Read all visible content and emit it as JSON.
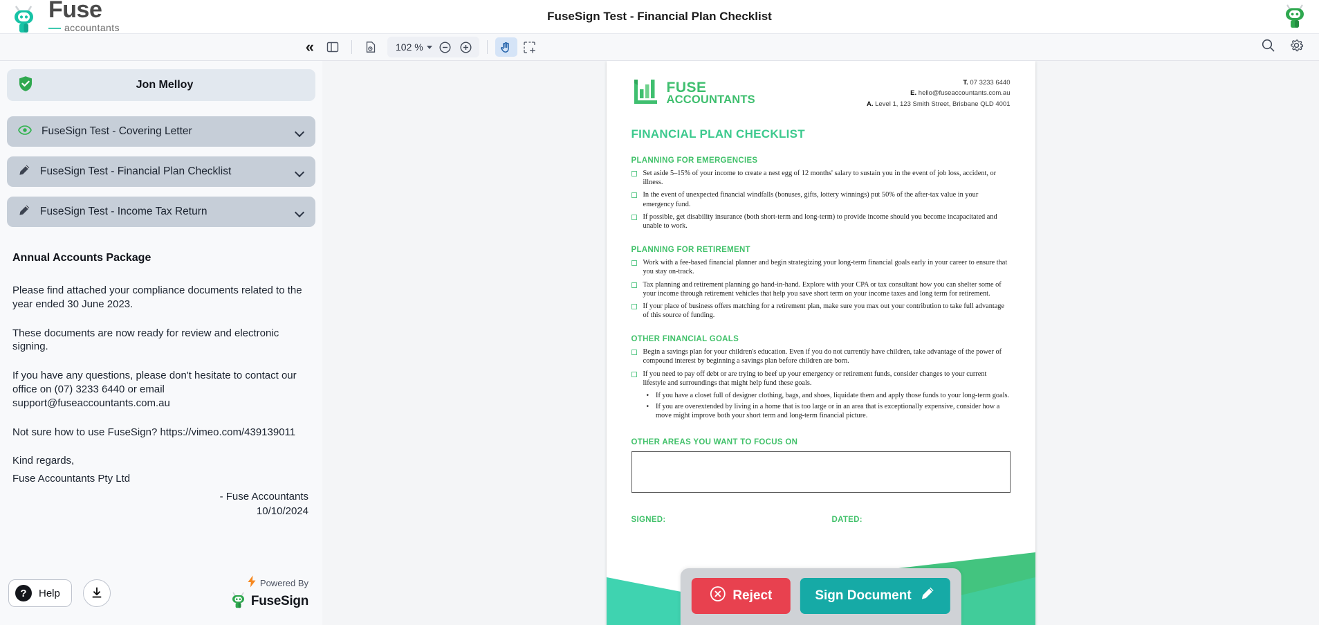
{
  "topbar": {
    "brand_primary": "Fuse",
    "brand_secondary": "accountants",
    "title": "FuseSign Test - Financial Plan Checklist",
    "avatar_icon": "fusesign-robot-avatar-icon"
  },
  "toolbar": {
    "collapse_icon": "double-chevron-left-icon",
    "sidebar_toggle_icon": "sidebar-panel-icon",
    "doc_properties_icon": "document-properties-icon",
    "zoom_value": "102 %",
    "zoom_caret_icon": "chevron-down-icon",
    "zoom_out_icon": "zoom-out-icon",
    "zoom_in_icon": "zoom-in-icon",
    "pan_tool_icon": "hand-pan-tool-icon",
    "select_tool_icon": "marquee-select-tool-icon",
    "search_icon": "search-icon",
    "settings_icon": "gear-icon"
  },
  "sidebar": {
    "recipient": {
      "name": "Jon Melloy",
      "status_icon": "shield-check-icon"
    },
    "documents": [
      {
        "label": "FuseSign Test - Covering Letter",
        "icon": "eye-icon",
        "icon_color": "#2eb24c",
        "expand_icon": "chevron-down-icon"
      },
      {
        "label": "FuseSign Test - Financial Plan Checklist",
        "icon": "pencil-icon",
        "icon_color": "#3c4350",
        "expand_icon": "chevron-down-icon"
      },
      {
        "label": "FuseSign Test - Income Tax Return",
        "icon": "pencil-icon",
        "icon_color": "#3c4350",
        "expand_icon": "chevron-down-icon"
      }
    ],
    "message": {
      "title": "Annual Accounts Package",
      "p1": "Please find attached your compliance documents related to the year ended 30 June 2023.",
      "p2": "These documents are now ready for review and electronic signing.",
      "p3": "If you have any questions, please don't hesitate to contact our office on (07) 3233 6440 or email support@fuseaccountants.com.au",
      "p4": "Not sure how to use FuseSign? https://vimeo.com/439139011",
      "signoff_line1": "Kind regards,",
      "signoff_line2": "Fuse Accountants Pty Ltd",
      "sender": "- Fuse Accountants",
      "date": "10/10/2024"
    },
    "footer": {
      "help_label": "Help",
      "help_icon": "question-mark-icon",
      "download_icon": "download-icon",
      "powered_by_label": "Powered By",
      "powered_bolt_icon": "lightning-bolt-icon",
      "powered_brand": "FuseSign",
      "powered_brand_icon": "fusesign-robot-icon"
    }
  },
  "document": {
    "logo_line1": "FUSE",
    "logo_line2": "ACCOUNTANTS",
    "logo_icon": "bar-chart-logo-icon",
    "contact": [
      {
        "prefix": "T.",
        "value": "07 3233 6440"
      },
      {
        "prefix": "E.",
        "value": "hello@fuseaccountants.com.au"
      },
      {
        "prefix": "A.",
        "value": "Level 1, 123 Smith Street, Brisbane QLD 4001"
      }
    ],
    "title": "FINANCIAL PLAN CHECKLIST",
    "sections": [
      {
        "heading": "PLANNING FOR EMERGENCIES",
        "items": [
          {
            "text": "Set aside 5–15% of your income to create a nest egg of 12 months' salary to sustain you in the event of job loss, accident, or illness."
          },
          {
            "text": "In the event of unexpected financial windfalls (bonuses, gifts, lottery winnings) put 50% of the after-tax value in your emergency fund."
          },
          {
            "text": "If possible, get disability insurance (both short-term and long-term) to provide income should you become incapacitated and unable to work."
          }
        ]
      },
      {
        "heading": "PLANNING FOR RETIREMENT",
        "items": [
          {
            "text": "Work with a fee-based financial planner and begin strategizing your long-term financial goals early in your career to ensure that you stay on-track."
          },
          {
            "text": "Tax planning and retirement planning go hand-in-hand. Explore with your CPA or tax consultant how you can shelter some of your income through retirement vehicles that help you save short term on your income taxes and long term for retirement."
          },
          {
            "text": "If your place of business offers matching for a retirement plan, make sure you max out your contribution to take full advantage of this source of funding."
          }
        ]
      },
      {
        "heading": "OTHER FINANCIAL GOALS",
        "items": [
          {
            "text": "Begin a savings plan for your children's education. Even if you do not currently have children, take advantage of the power of compound interest by beginning a savings plan before children are born."
          },
          {
            "text": "If you need to pay off debt or are trying to beef up your emergency or retirement funds, consider changes to your current lifestyle and surroundings that might help fund these goals.",
            "subitems": [
              "If you have a closet full of designer clothing, bags, and shoes, liquidate them and apply those funds to your long-term goals.",
              "If you are overextended by living in a home that is too large or in an area that is exceptionally expensive, consider how a move might improve both your short term and long-term financial picture."
            ]
          }
        ]
      }
    ],
    "focus_heading": "OTHER AREAS YOU WANT TO FOCUS ON",
    "focus_value": "",
    "signed_label": "SIGNED:",
    "dated_label": "DATED:"
  },
  "actions": {
    "reject_label": "Reject",
    "reject_icon": "circle-x-icon",
    "reject_color": "#e8414f",
    "sign_label": "Sign Document",
    "sign_icon": "pencil-icon",
    "sign_color": "#16aaa6"
  },
  "colors": {
    "brand_teal": "#3ec9b0",
    "doc_green": "#41c16a",
    "accent_green": "#3bc98d"
  }
}
